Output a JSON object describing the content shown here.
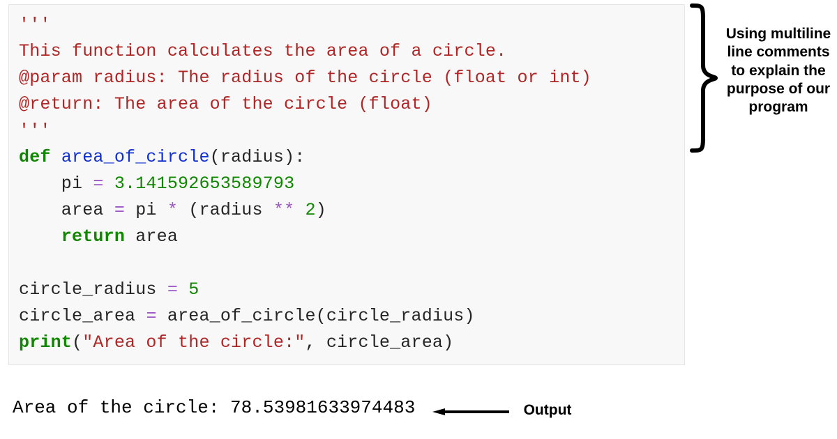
{
  "code": {
    "docstring_open": "'''",
    "doc_line1": "This function calculates the area of a circle.",
    "doc_line2": "@param radius: The radius of the circle (float or int)",
    "doc_line3": "@return: The area of the circle (float)",
    "docstring_close": "'''",
    "def_kw": "def",
    "func_name": "area_of_circle",
    "func_params_open": "(",
    "func_param": "radius",
    "func_params_close": "):",
    "pi_lhs": "    pi ",
    "eq1": "=",
    "pi_val": " 3.141592653589793",
    "area_lhs": "    area ",
    "eq2": "=",
    "area_rhs1": " pi ",
    "star": "*",
    "area_rhs2": " (radius ",
    "dblstar": "**",
    "two": " 2",
    "area_rhs_close": ")",
    "return_kw": "    return",
    "return_var": " area",
    "blank": "",
    "cr_line": "circle_radius ",
    "eq3": "=",
    "cr_val": " 5",
    "ca_line": "circle_area ",
    "eq4": "=",
    "ca_call": " area_of_circle(circle_radius)",
    "print_kw": "print",
    "print_open": "(",
    "print_str": "\"Area of the circle:\"",
    "print_rest": ", circle_area)",
    "output": "Area of the circle: 78.53981633974483"
  },
  "annotations": {
    "comments_label": "Using multiline line comments to explain the purpose of our program",
    "output_label": "Output"
  },
  "colors": {
    "comment": "#b02626",
    "keyword": "#108700",
    "function": "#1030d0",
    "operator": "#9b57c6",
    "background": "#f8f8f8"
  }
}
